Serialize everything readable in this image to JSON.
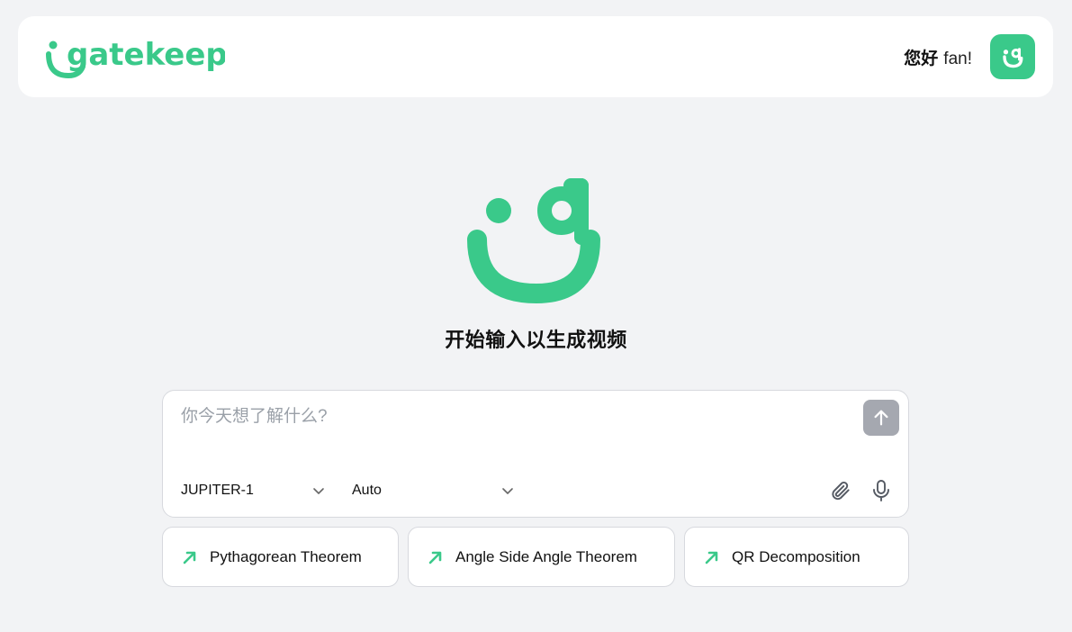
{
  "brand": {
    "name": "gatekeep",
    "color": "#3ac98a"
  },
  "header": {
    "greeting": "您好",
    "user_name": "fan!"
  },
  "hero": {
    "title": "开始输入以生成视频"
  },
  "composer": {
    "placeholder": "你今天想了解什么?",
    "value": "",
    "model": {
      "selected": "JUPITER-1"
    },
    "mode": {
      "selected": "Auto"
    },
    "icons": {
      "send": "arrow-up-icon",
      "attach": "paperclip-icon",
      "mic": "microphone-icon"
    }
  },
  "suggestions": [
    {
      "label": "Pythagorean Theorem",
      "icon": "arrow-up-right-icon"
    },
    {
      "label": "Angle Side Angle Theorem",
      "icon": "arrow-up-right-icon"
    },
    {
      "label": "QR Decomposition",
      "icon": "arrow-up-right-icon"
    }
  ]
}
